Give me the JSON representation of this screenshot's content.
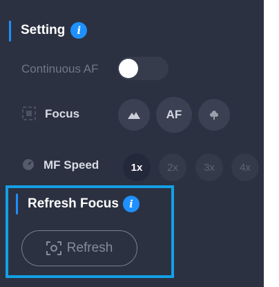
{
  "setting": {
    "title": "Setting",
    "info_icon": "i"
  },
  "continuous_af": {
    "label": "Continuous AF",
    "enabled": true
  },
  "focus": {
    "label": "Focus",
    "options": [
      {
        "icon": "mountain-icon",
        "label": ""
      },
      {
        "icon": "",
        "label": "AF"
      },
      {
        "icon": "flower-macro-icon",
        "label": ""
      }
    ]
  },
  "mf_speed": {
    "label": "MF Speed",
    "options": [
      "1x",
      "2x",
      "3x",
      "4x"
    ],
    "selected": "1x"
  },
  "refresh_focus": {
    "title": "Refresh Focus",
    "info_icon": "i",
    "button_label": "Refresh"
  },
  "colors": {
    "panel_bg": "#2c3141",
    "accent": "#1e90ff",
    "highlight_border": "#12a0e6"
  }
}
